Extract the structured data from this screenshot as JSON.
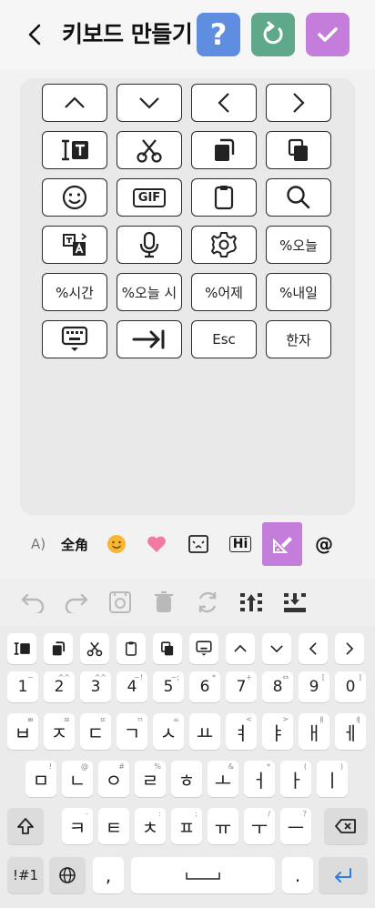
{
  "header": {
    "title": "키보드 만들기",
    "help_label": "?"
  },
  "editor_keys": [
    {
      "name": "chevron-up-icon",
      "type": "icon"
    },
    {
      "name": "chevron-down-icon",
      "type": "icon"
    },
    {
      "name": "chevron-left-icon",
      "type": "icon"
    },
    {
      "name": "chevron-right-icon",
      "type": "icon"
    },
    {
      "name": "text-cursor-icon",
      "type": "icon"
    },
    {
      "name": "scissors-icon",
      "type": "icon"
    },
    {
      "name": "copy-icon",
      "type": "icon"
    },
    {
      "name": "paste-icon",
      "type": "icon"
    },
    {
      "name": "emoji-icon",
      "type": "icon"
    },
    {
      "name": "gif-icon",
      "type": "icon"
    },
    {
      "name": "clipboard-icon",
      "type": "icon"
    },
    {
      "name": "search-icon",
      "type": "icon"
    },
    {
      "name": "translate-icon",
      "type": "icon"
    },
    {
      "name": "microphone-icon",
      "type": "icon"
    },
    {
      "name": "settings-icon",
      "type": "icon"
    },
    {
      "name": "today-key",
      "type": "text",
      "label": "%오늘"
    },
    {
      "name": "time-key",
      "type": "text",
      "label": "%시간"
    },
    {
      "name": "today-time-key",
      "type": "text",
      "label": "%오늘 시"
    },
    {
      "name": "yesterday-key",
      "type": "text",
      "label": "%어제"
    },
    {
      "name": "tomorrow-key",
      "type": "text",
      "label": "%내일"
    },
    {
      "name": "keyboard-hide-icon",
      "type": "icon"
    },
    {
      "name": "tab-icon",
      "type": "icon"
    },
    {
      "name": "esc-key",
      "type": "text",
      "label": "Esc"
    },
    {
      "name": "hanja-key",
      "type": "text",
      "label": "한자"
    }
  ],
  "tabs": {
    "partial": "A)",
    "fullwidth": "全角",
    "at": "@",
    "gif_hi": "Hi"
  },
  "gif_label": "GIF",
  "keyboard": {
    "numbers": [
      {
        "k": "1",
        "h": "~"
      },
      {
        "k": "2",
        "h": "^^"
      },
      {
        "k": "3",
        "h": "^^"
      },
      {
        "k": "4",
        "h": "~!"
      },
      {
        "k": "5",
        "h": "~;"
      },
      {
        "k": "6",
        "h": "*"
      },
      {
        "k": "7",
        "h": "+"
      },
      {
        "k": "8",
        "h": "⇔"
      },
      {
        "k": "9",
        "h": "["
      },
      {
        "k": "0",
        "h": "]"
      }
    ],
    "row1": [
      {
        "k": "ㅂ",
        "h": "ㅃ"
      },
      {
        "k": "ㅈ",
        "h": "ㅉ"
      },
      {
        "k": "ㄷ",
        "h": "ㄸ"
      },
      {
        "k": "ㄱ",
        "h": "ㄲ"
      },
      {
        "k": "ㅅ",
        "h": "ㅆ"
      },
      {
        "k": "ㅛ",
        "h": ""
      },
      {
        "k": "ㅕ",
        "h": "<"
      },
      {
        "k": "ㅑ",
        "h": ">"
      },
      {
        "k": "ㅐ",
        "h": "ㅒ"
      },
      {
        "k": "ㅔ",
        "h": "ㅖ"
      }
    ],
    "row2": [
      {
        "k": "ㅁ",
        "h": "!"
      },
      {
        "k": "ㄴ",
        "h": "@"
      },
      {
        "k": "ㅇ",
        "h": "#"
      },
      {
        "k": "ㄹ",
        "h": "%"
      },
      {
        "k": "ㅎ",
        "h": ""
      },
      {
        "k": "ㅗ",
        "h": "&"
      },
      {
        "k": "ㅓ",
        "h": "*"
      },
      {
        "k": "ㅏ",
        "h": "("
      },
      {
        "k": "ㅣ",
        "h": ")"
      }
    ],
    "row3": [
      {
        "k": "ㅋ",
        "h": "-"
      },
      {
        "k": "ㅌ",
        "h": ""
      },
      {
        "k": "ㅊ",
        "h": ":"
      },
      {
        "k": "ㅍ",
        "h": ";"
      },
      {
        "k": "ㅠ",
        "h": ""
      },
      {
        "k": "ㅜ",
        "h": "/"
      },
      {
        "k": "ㅡ",
        "h": "?"
      }
    ],
    "symbols_label": "!#1",
    "comma": ",",
    "period": "."
  }
}
